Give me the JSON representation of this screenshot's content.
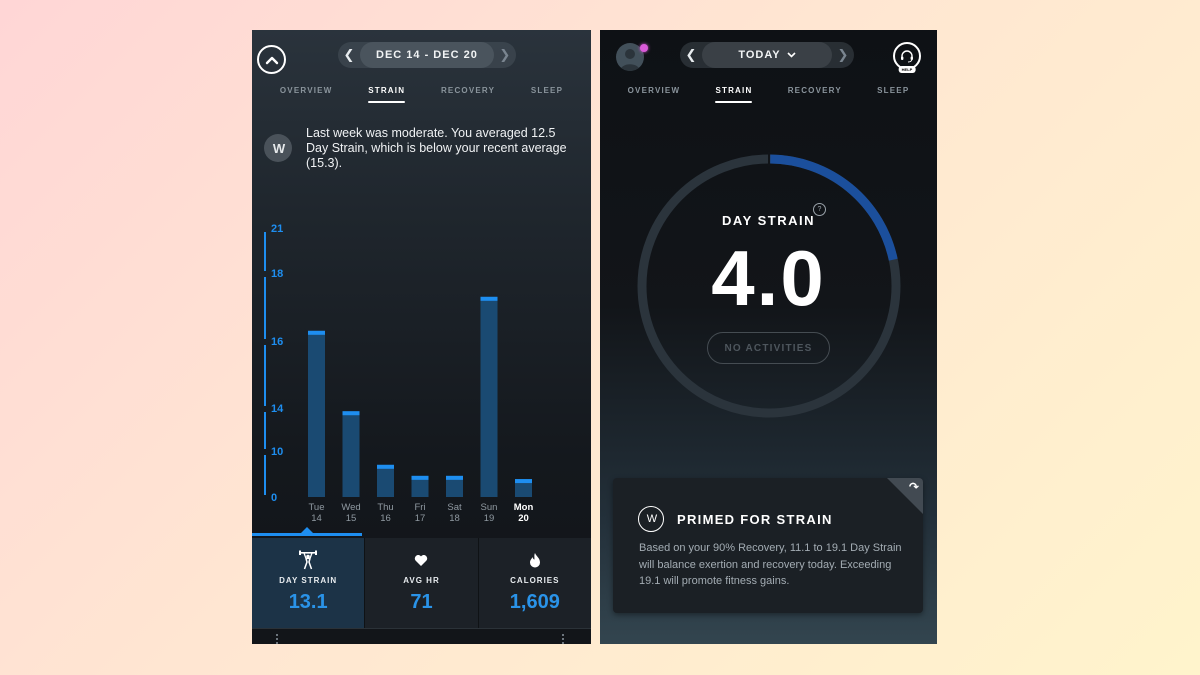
{
  "left_screen": {
    "date_range": "DEC 14 - DEC 20",
    "prev_icon": "chevron-left-icon",
    "next_icon": "chevron-right-icon",
    "collapse_icon": "chevron-up-icon",
    "tabs": [
      {
        "label": "OVERVIEW",
        "active": false
      },
      {
        "label": "STRAIN",
        "active": true
      },
      {
        "label": "RECOVERY",
        "active": false
      },
      {
        "label": "SLEEP",
        "active": false
      }
    ],
    "insight": {
      "badge": "W",
      "text": "Last week was moderate. You averaged 12.5 Day Strain, which is below your recent average (15.3)."
    },
    "stats": [
      {
        "label": "DAY STRAIN",
        "value": "13.1",
        "icon": "weightlifter-icon",
        "selected": true
      },
      {
        "label": "AVG HR",
        "value": "71",
        "icon": "heart-icon",
        "selected": false
      },
      {
        "label": "CALORIES",
        "value": "1,609",
        "icon": "flame-icon",
        "selected": false
      }
    ]
  },
  "chart_data": {
    "type": "bar",
    "title": "",
    "xlabel": "",
    "ylabel": "",
    "y_ticks": [
      0,
      10,
      14,
      16,
      18,
      21
    ],
    "ylim": [
      0,
      21
    ],
    "categories": [
      {
        "day": "Tue",
        "date": "14"
      },
      {
        "day": "Wed",
        "date": "15"
      },
      {
        "day": "Thu",
        "date": "16"
      },
      {
        "day": "Fri",
        "date": "17"
      },
      {
        "day": "Sat",
        "date": "18"
      },
      {
        "day": "Sun",
        "date": "19"
      },
      {
        "day": "Mon",
        "date": "20"
      }
    ],
    "values": [
      16.3,
      13.7,
      7.0,
      4.6,
      4.6,
      17.3,
      3.9
    ],
    "highlight_category": "Mon",
    "bar_color": "#1a4a72",
    "bar_cap_color": "#1e8ef0",
    "axis_color": "#1e8ef0",
    "grid": false
  },
  "right_screen": {
    "date_label": "TODAY",
    "dropdown_icon": "chevron-down-icon",
    "prev_icon": "chevron-left-icon",
    "next_icon": "chevron-right-icon",
    "help_label": "HELP",
    "notification_color": "#d95ad8",
    "tabs": [
      {
        "label": "OVERVIEW",
        "active": false
      },
      {
        "label": "STRAIN",
        "active": true
      },
      {
        "label": "RECOVERY",
        "active": false
      },
      {
        "label": "SLEEP",
        "active": false
      }
    ],
    "gauge": {
      "title": "DAY STRAIN",
      "help_glyph": "?",
      "value": "4.0",
      "value_num": 4.0,
      "max": 21,
      "fill_color": "#1b4f9c",
      "track_color": "#2b343c",
      "activities_label": "NO ACTIVITIES"
    },
    "card": {
      "badge": "W",
      "title": "PRIMED FOR STRAIN",
      "body": "Based on your 90% Recovery, 11.1 to 19.1 Day Strain will balance exertion and recovery today. Exceeding 19.1 will promote fitness gains.",
      "corner_icon": "share-arrow-icon"
    }
  }
}
